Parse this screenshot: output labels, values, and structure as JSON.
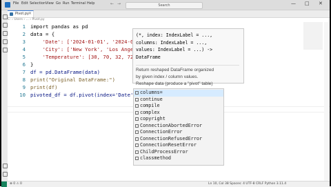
{
  "titlebar": {
    "menus": [
      "File",
      "Edit",
      "Selection",
      "View",
      "Go",
      "Run",
      "Terminal",
      "Help"
    ],
    "search_label": "Search",
    "back_icon": "arrow-left-icon",
    "forward_icon": "arrow-right-icon",
    "window_controls": [
      "—",
      "□",
      "✕"
    ]
  },
  "tabs": [
    {
      "label": "Pivot.py",
      "icon": "python-file-icon"
    }
  ],
  "breadcrumb": "C: › Users › ... › Pivot.py",
  "editor": {
    "lines": [
      {
        "num": "1",
        "code": "import pandas as pd"
      },
      {
        "num": "2",
        "code": "data = {"
      },
      {
        "num": "3",
        "code": "    'Date': ['2024-01-01', '2024-01-01'"
      },
      {
        "num": "4",
        "code": "    'City': ['New York', 'Los Angeles'"
      },
      {
        "num": "5",
        "code": "    'Temperature': [30, 70, 32, 72]"
      },
      {
        "num": "6",
        "code": "}"
      },
      {
        "num": "7",
        "code": "df = pd.DataFrame(data)"
      },
      {
        "num": "8",
        "code": "print(\"Original DataFrame:\")"
      },
      {
        "num": "9",
        "code": "print(df)"
      },
      {
        "num": "10",
        "code": "pivoted_df = df.pivot(index='Date', co"
      }
    ]
  },
  "signature_popup": {
    "lines": [
      "(*, index: IndexLabel = ...,",
      "columns: IndexLabel = ...,",
      "values: IndexLabel = ...) ->",
      "DataFrame"
    ],
    "desc": [
      "Return reshaped DataFrame organized",
      "by given index / column values.",
      "Reshape data (produce a \"pivot\" table)"
    ]
  },
  "suggestions": [
    "columns=",
    "continue",
    "compile",
    "complex",
    "copyright",
    "ConnectionAbortedError",
    "ConnectionError",
    "ConnectionRefusedError",
    "ConnectionResetError",
    "ChildProcessError",
    "classmethod"
  ],
  "statusbar": {
    "left": "⊗ 0 ⚠ 0",
    "right": "Ln 10, Col 38   Spaces: 4   UTF-8   CRLF   Python   3.11.4"
  },
  "colors": {
    "keyword": "#af00db",
    "string": "#a31515",
    "number": "#098658",
    "line_number": "#237893"
  }
}
